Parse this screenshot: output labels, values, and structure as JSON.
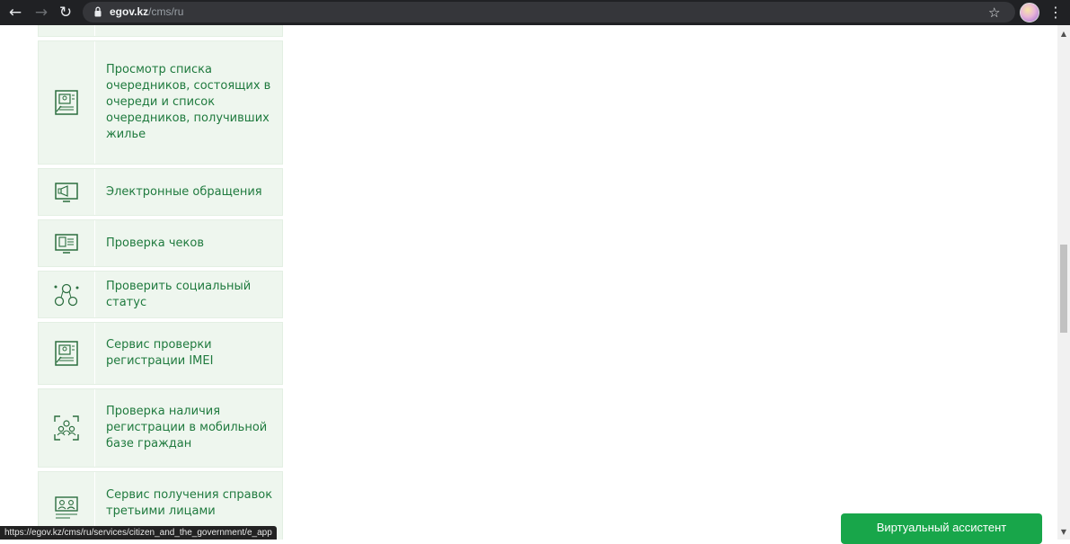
{
  "browser": {
    "url_host": "egov.kz",
    "url_path": "/cms/ru"
  },
  "services": [
    {
      "label": "Просмотр списка очередников, состоящих в очереди и список очередников, получивших жилье",
      "icon": "document-list-icon"
    },
    {
      "label": "Электронные обращения",
      "icon": "megaphone-monitor-icon"
    },
    {
      "label": "Проверка чеков",
      "icon": "receipt-monitor-icon"
    },
    {
      "label": "Проверить социальный статус",
      "icon": "social-network-icon"
    },
    {
      "label": "Сервис проверки регистрации IMEI",
      "icon": "document-list-icon"
    },
    {
      "label": "Проверка наличия регистрации в мобильной базе граждан",
      "icon": "people-focus-icon"
    },
    {
      "label": "Сервис получения справок третьими лицами",
      "icon": "people-board-icon"
    }
  ],
  "status_url": "https://egov.kz/cms/ru/services/citizen_and_the_government/e_app",
  "assistant_label": "Виртуальный ассистент",
  "colors": {
    "card_bg": "#eef6ee",
    "text_green": "#1f7a3e",
    "assistant_green": "#18a64a"
  }
}
